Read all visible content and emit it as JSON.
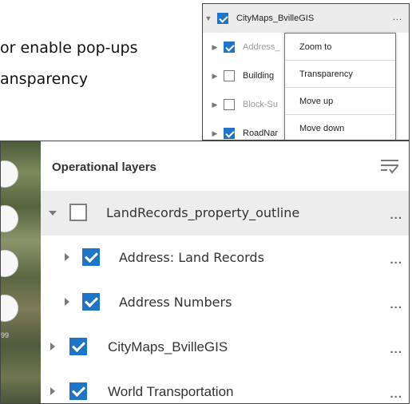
{
  "background_text": {
    "line1": "or enable pop-ups",
    "line2": "ansparency"
  },
  "mini_panel": {
    "rows": [
      {
        "label": "CityMaps_BvilleGIS",
        "checked": true,
        "dim": false
      },
      {
        "label": "Address_",
        "checked": true,
        "dim": true
      },
      {
        "label": "Building",
        "checked": false,
        "dim": false
      },
      {
        "label": "Block-Su",
        "checked": false,
        "dim": true
      },
      {
        "label": "RoadNar",
        "checked": true,
        "dim": false
      }
    ],
    "more_label": "...",
    "menu": [
      "Zoom to",
      "Transparency",
      "Move up",
      "Move down"
    ]
  },
  "panel": {
    "title": "Operational layers",
    "map_label": "99",
    "layers": [
      {
        "label": "LandRecords_property_outline",
        "checked": false,
        "expanded": true
      },
      {
        "label": "Address: Land Records",
        "checked": true,
        "expanded": false
      },
      {
        "label": "Address Numbers",
        "checked": true,
        "expanded": false
      },
      {
        "label": "CityMaps_BvilleGIS",
        "checked": true,
        "expanded": false
      },
      {
        "label": "World Transportation",
        "checked": true,
        "expanded": false
      }
    ],
    "more_label": "...",
    "accent_color": "#1e74c8"
  }
}
